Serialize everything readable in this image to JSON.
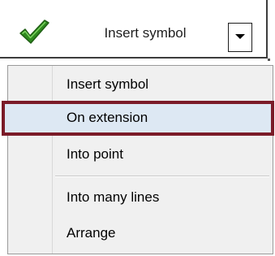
{
  "split_button": {
    "label": "Insert symbol",
    "icon": "green-check-icon"
  },
  "menu": {
    "items": [
      {
        "label": "Insert symbol",
        "highlighted": false
      },
      {
        "label": "On extension",
        "highlighted": true
      },
      {
        "label": "Into point",
        "highlighted": false
      },
      {
        "label": "Into many lines",
        "highlighted": false
      },
      {
        "label": "Arrange",
        "highlighted": false
      }
    ]
  },
  "colors": {
    "highlight_fill": "#dde8f3",
    "highlight_border": "#7b1b28",
    "check_green": "#2f8a1f"
  }
}
